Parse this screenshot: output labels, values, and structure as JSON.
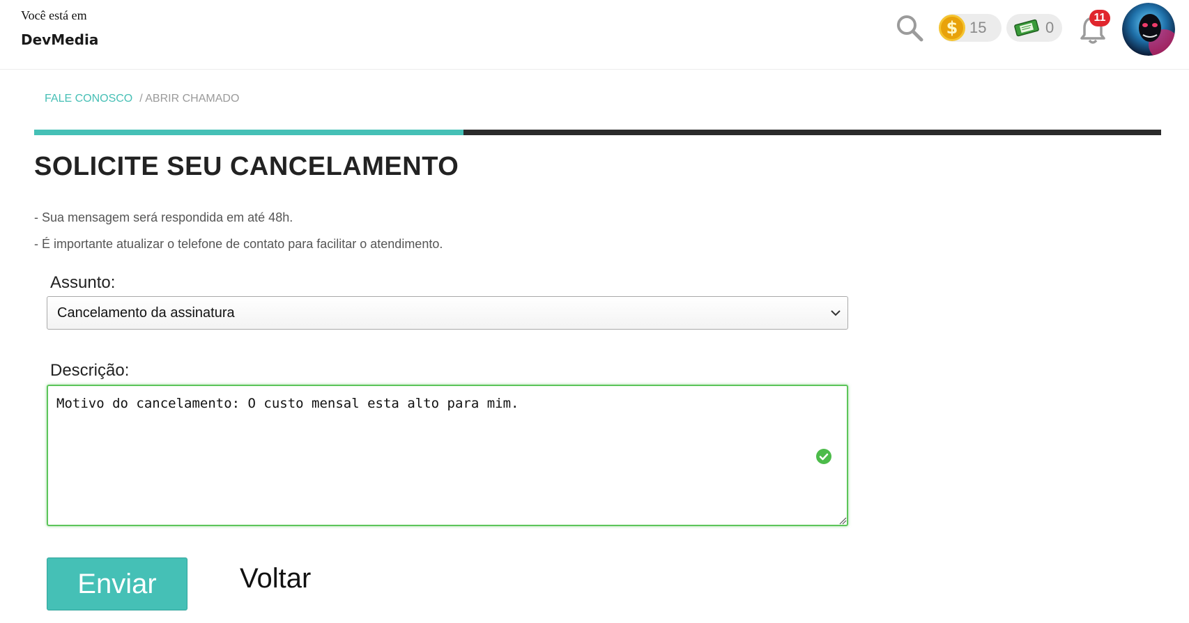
{
  "header": {
    "brand_prefix": "Você está em",
    "brand_name": "DevMedia",
    "coins": "15",
    "tickets": "0",
    "notifications": "11",
    "coin_symbol": "$"
  },
  "breadcrumb": {
    "link": "FALE CONOSCO",
    "current": "/ ABRIR CHAMADO"
  },
  "progress": {
    "fraction": 0.381,
    "fill_color": "#45c0b6",
    "track_color": "#2b2b2b"
  },
  "page": {
    "title": "SOLICITE SEU CANCELAMENTO",
    "notes": [
      "- Sua mensagem será respondida em até 48h.",
      "- É importante atualizar o telefone de contato para facilitar o atendimento."
    ]
  },
  "form": {
    "subject_label": "Assunto:",
    "subject_value": "Cancelamento da assinatura",
    "description_label": "Descrição:",
    "description_value": "Motivo do cancelamento: O custo mensal esta alto para mim.",
    "description_valid": true,
    "send_label": "Enviar",
    "back_label": "Voltar"
  },
  "icons": {
    "search": "search-icon",
    "coin": "coin-icon",
    "ticket": "ticket-icon",
    "bell": "bell-icon",
    "avatar": "avatar",
    "chevron": "chevron-down-icon",
    "check": "check-circle-icon"
  },
  "colors": {
    "accent": "#45c0b6",
    "valid_border": "#5cc55a",
    "badge": "#e0262d",
    "coin": "#e8a20b"
  }
}
